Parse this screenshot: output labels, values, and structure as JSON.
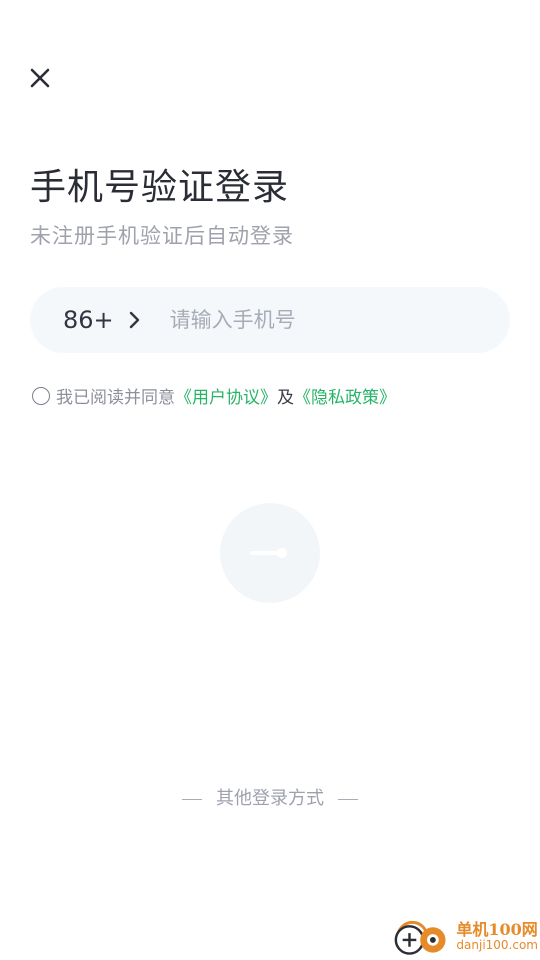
{
  "header": {
    "close_icon": "close-icon"
  },
  "login": {
    "title": "手机号验证登录",
    "subtitle": "未注册手机验证后自动登录"
  },
  "phone": {
    "country_code": "86+",
    "chevron_icon": "chevron-right-icon",
    "placeholder": "请输入手机号",
    "value": ""
  },
  "agreement": {
    "prefix": "我已阅读并同意",
    "user_agreement": "《用户协议》",
    "conjunction": "及",
    "privacy_policy": "《隐私政策》",
    "checked": false
  },
  "submit": {
    "icon": "arrow-right-icon",
    "enabled": false
  },
  "other_login": {
    "label": "其他登录方式"
  },
  "watermark": {
    "cn": "单机100网",
    "en": "danji100.com"
  },
  "colors": {
    "link": "#27b467",
    "input_bg": "#f5f8fb",
    "muted": "#9ea2ad",
    "watermark": "#e58b2a"
  }
}
